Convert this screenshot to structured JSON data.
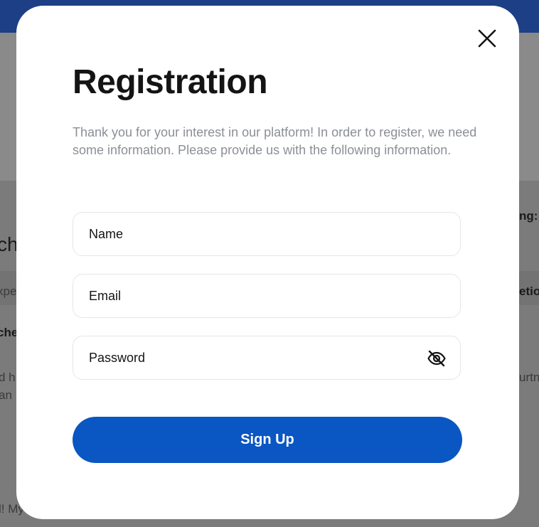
{
  "background": {
    "left_fragments": [
      "ch",
      "xpe",
      "che",
      "d h",
      "an",
      "l! My"
    ],
    "right_fragments": [
      "ng:",
      "etio",
      "urtn"
    ]
  },
  "modal": {
    "title": "Registration",
    "intro": "Thank you for your interest in our platform! In order to register, we need some information. Please provide us with the following information.",
    "fields": {
      "name_placeholder": "Name",
      "email_placeholder": "Email",
      "password_placeholder": "Password"
    },
    "signup_label": "Sign Up",
    "close_icon": "close-icon",
    "eye_icon": "eye-off-icon"
  },
  "colors": {
    "accent": "#0a56c2",
    "header": "#1c3f86",
    "overlay": "#7b7b7b"
  }
}
